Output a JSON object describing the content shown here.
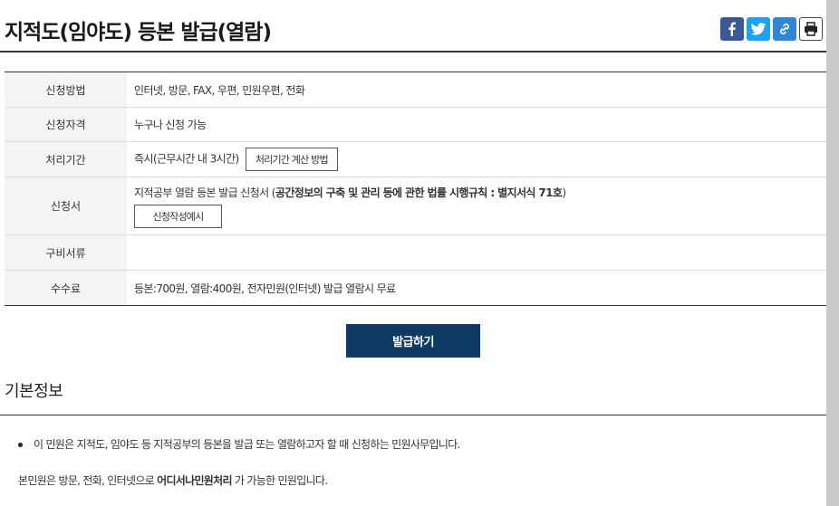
{
  "header": {
    "title": "지적도(임야도) 등본 발급(열람)"
  },
  "share": {
    "facebook_icon": "facebook-icon",
    "twitter_icon": "twitter-icon",
    "link_icon": "link-icon",
    "print_icon": "print-icon"
  },
  "info": {
    "rows": [
      {
        "label": "신청방법",
        "value": "인터넷, 방문, FAX, 우편, 민원우편, 전화"
      },
      {
        "label": "신청자격",
        "value": "누구나 신청 가능"
      },
      {
        "label": "처리기간",
        "value": "즉시(근무시간 내 3시간)",
        "button": "처리기간 계산 방법"
      },
      {
        "label": "신청서",
        "value": "지적공부 열람 등본 발급 신청서 (",
        "value_bold": "공간정보의 구축 및 관리 등에 관한 법률 시행규칙 : 별지서식 71호",
        "value_end": ")",
        "button": "신청작성예시"
      },
      {
        "label": "구비서류",
        "value": ""
      },
      {
        "label": "수수료",
        "value": "등본:700원, 열람:400원, 전자민원(인터넷) 발급 열람시 무료"
      }
    ]
  },
  "actions": {
    "issue_label": "발급하기"
  },
  "basic_info": {
    "title": "기본정보",
    "bullet": "이 민원은 지적도, 임야도 등 지적공부의 등본을 발급 또는 열람하고자 할 때 신청하는 민원사무입니다.",
    "para_prefix": "본민원은 방문, 전화, 인터넷으로 ",
    "para_bold": "어디서나민원처리",
    "para_suffix": " 가 가능한 민원입니다."
  },
  "colors": {
    "primary": "#0f3a63",
    "facebook": "#3b5998",
    "twitter": "#1da1f2",
    "link": "#2f86d6"
  }
}
